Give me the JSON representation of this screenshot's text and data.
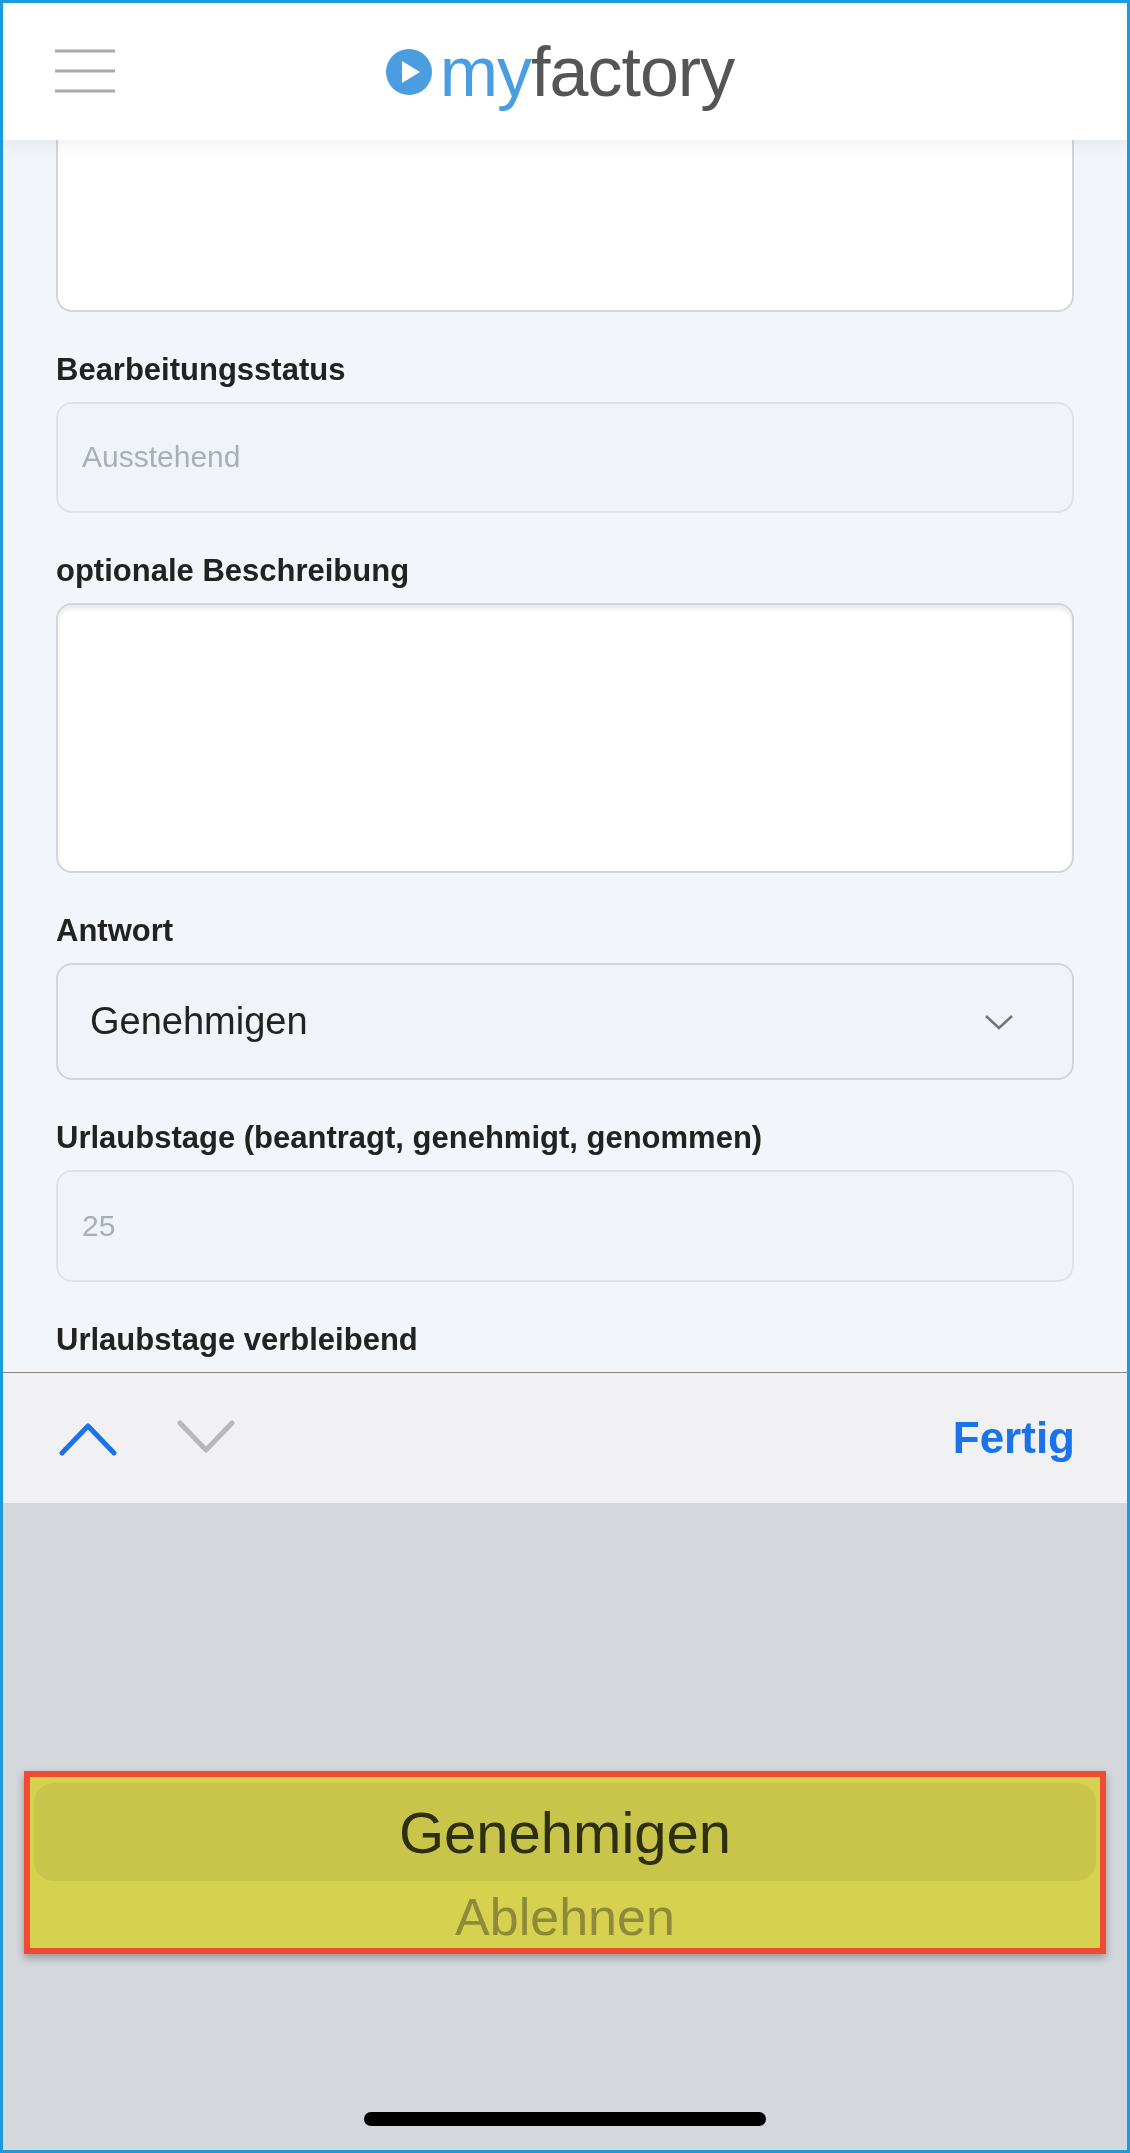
{
  "header": {
    "logo": {
      "accent": "my",
      "rest": "factory"
    }
  },
  "fields": [
    {
      "kind": "textarea"
    },
    {
      "kind": "input",
      "label": "Bearbeitungsstatus",
      "value": "Ausstehend",
      "disabled": true
    },
    {
      "kind": "textarea",
      "label": "optionale Beschreibung"
    },
    {
      "kind": "select",
      "label": "Antwort",
      "value": "Genehmigen"
    },
    {
      "kind": "input",
      "label": "Urlaubstage (beantragt, genehmigt, genommen)",
      "value": "25",
      "disabled": true
    },
    {
      "kind": "label",
      "label": "Urlaubstage verbleibend"
    }
  ],
  "toolbar": {
    "previous": {
      "disabled": false
    },
    "next": {
      "disabled": true
    },
    "done": "Fertig"
  },
  "picker": {
    "options": [
      {
        "label": "Genehmigen",
        "selected": true
      },
      {
        "label": "Ablehnen",
        "selected": false
      }
    ]
  }
}
